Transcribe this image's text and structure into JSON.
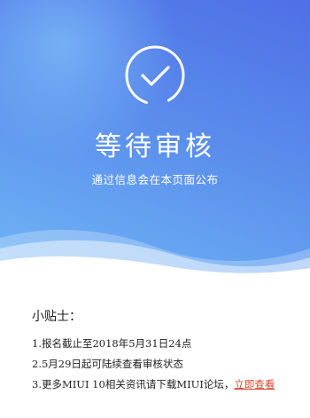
{
  "status": {
    "icon": "check-circle-icon",
    "title": "等待审核",
    "subtitle": "通过信息会在本页面公布"
  },
  "tips": {
    "heading": "小贴士：",
    "items": [
      {
        "text": "1.报名截止至2018年5月31日24点"
      },
      {
        "text": "2.5月29日起可陆续查看审核状态"
      },
      {
        "text": "3.更多MIUI 10相关资讯请下载MIUI论坛，",
        "link": "立即查看"
      }
    ]
  },
  "colors": {
    "gradient_start": "#6fb6f5",
    "gradient_end": "#4f6fe6",
    "link": "#d9452f"
  }
}
